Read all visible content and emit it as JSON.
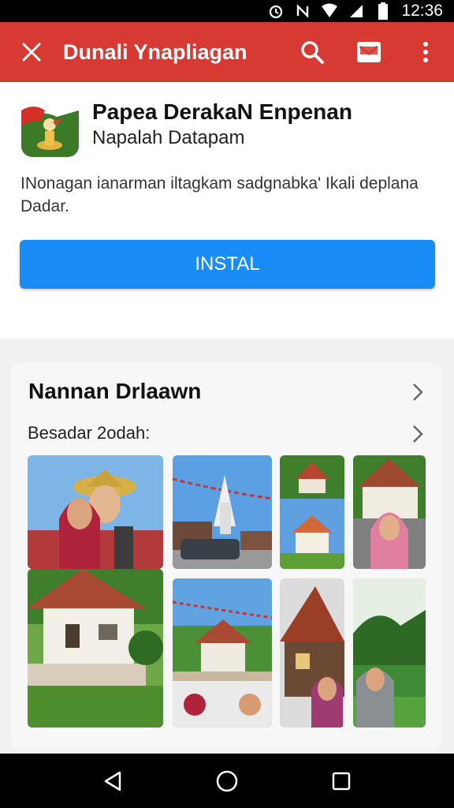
{
  "status_bar": {
    "time": "12:36"
  },
  "app_bar": {
    "title": "Dunali Ynapliagan"
  },
  "app": {
    "name": "Papea DerakaN Enpenan",
    "developer": "Napalah Datapam",
    "description": "INonagan ianarman iltagkam sadgnabka' Ikali deplana Dadar.",
    "install_label": "INSTAL"
  },
  "section": {
    "title": "Nannan Drlaawn",
    "subtitle": "Besadar 2odah:"
  },
  "thumbnails": [
    {
      "name": "thumb-women-hijab-hat"
    },
    {
      "name": "thumb-monument-car"
    },
    {
      "name": "thumb-pavilion-small"
    },
    {
      "name": "thumb-woman-pink-hijab-house"
    },
    {
      "name": "thumb-traditional-house"
    },
    {
      "name": "thumb-village-flags"
    },
    {
      "name": "thumb-house-woman-purple"
    },
    {
      "name": "thumb-woman-gray-hijab-garden"
    }
  ],
  "colors": {
    "app_bar": "#d63a33",
    "install": "#1a8cf5"
  },
  "icons": [
    "close-icon",
    "search-icon",
    "mail-icon",
    "more-vert-icon",
    "back-icon",
    "home-icon",
    "recents-icon"
  ]
}
